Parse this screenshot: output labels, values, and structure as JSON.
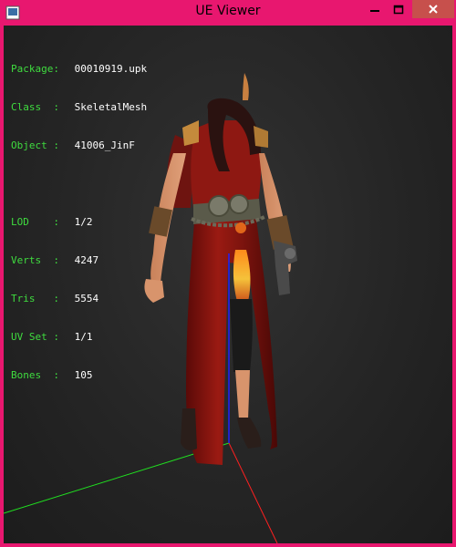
{
  "window": {
    "title": "UE Viewer",
    "frame_color": "#e8176f",
    "close_color": "#c7504c",
    "icons": {
      "app": "app-icon",
      "minimize": "minimize-icon",
      "maximize": "maximize-icon",
      "close": "close-icon"
    }
  },
  "info": {
    "label_color": "#3fdc3f",
    "value_color": "#ffffff",
    "package_label": "Package:",
    "package_value": "00010919.upk",
    "class_label": "Class  :",
    "class_value": "SkeletalMesh",
    "object_label": "Object :",
    "object_value": "41006_JinF",
    "lod_label": "LOD    :",
    "lod_value": "1/2",
    "verts_label": "Verts  :",
    "verts_value": "4247",
    "tris_label": "Tris   :",
    "tris_value": "5554",
    "uvset_label": "UV Set :",
    "uvset_value": "1/1",
    "bones_label": "Bones  :",
    "bones_value": "105"
  },
  "scene": {
    "background": "#262626",
    "axis_x_color": "#ff2020",
    "axis_y_color": "#20e020",
    "axis_z_color": "#2020ff",
    "model": "skeletal-mesh-figure"
  }
}
